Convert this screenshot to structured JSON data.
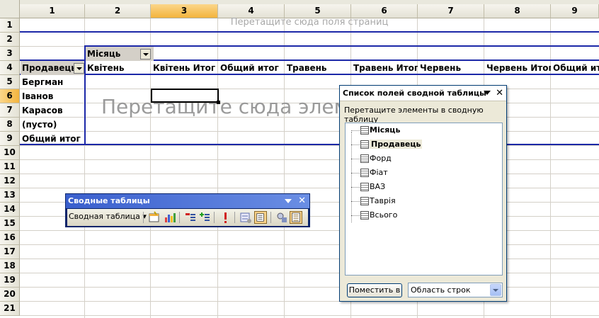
{
  "spreadsheet": {
    "columns": [
      "1",
      "2",
      "3",
      "4",
      "5",
      "6",
      "7",
      "8",
      "9"
    ],
    "selected_column": "3",
    "rows": [
      "1",
      "2",
      "3",
      "4",
      "5",
      "6",
      "7",
      "8",
      "9",
      "10",
      "11",
      "12",
      "13",
      "14",
      "15",
      "16",
      "17",
      "18",
      "19",
      "20",
      "21"
    ],
    "selected_row": "6",
    "page_fields_hint": "Перетащите сюда поля страниц",
    "data_hint": "Перетащите сюда элем",
    "pivot": {
      "page_field": "Місяць",
      "row_field": "Продавець",
      "col_headers": [
        "Квітень",
        "Квітень Итог",
        "Общий итог",
        "Травень",
        "Травень Итог",
        "Червень",
        "Червень Итог",
        "Общий итог"
      ],
      "row_items": [
        "Бергман",
        "Іванов",
        "Карасов",
        "(пусто)",
        "Общий итог"
      ]
    }
  },
  "field_list": {
    "title": "Список полей сводной таблицы",
    "instruction": "Перетащите элементы в сводную таблицу",
    "fields": [
      {
        "label": "Місяць",
        "bold": true
      },
      {
        "label": "Продавець",
        "bold": true
      },
      {
        "label": "Форд",
        "bold": false
      },
      {
        "label": "Фіат",
        "bold": false
      },
      {
        "label": "ВАЗ",
        "bold": false
      },
      {
        "label": "Таврія",
        "bold": false
      },
      {
        "label": "Всього",
        "bold": false
      }
    ],
    "add_button": "Поместить в",
    "area_select": "Область строк",
    "close_icon": "close-icon",
    "menu_icon": "chevron-down-icon"
  },
  "pivot_toolbar": {
    "title": "Сводные таблицы",
    "menu_label": "Сводная таблица ▾",
    "icons": [
      "format-report-icon",
      "chart-wizard-icon",
      "hide-detail-icon",
      "show-detail-icon",
      "refresh-icon",
      "field-settings-icon",
      "show-items-icon",
      "always-display-items-icon",
      "field-list-icon"
    ]
  },
  "colors": {
    "pivot_border": "#1c28a8",
    "selected_header": "#f3b43d",
    "toolbar_title": "#3a5fcd"
  }
}
